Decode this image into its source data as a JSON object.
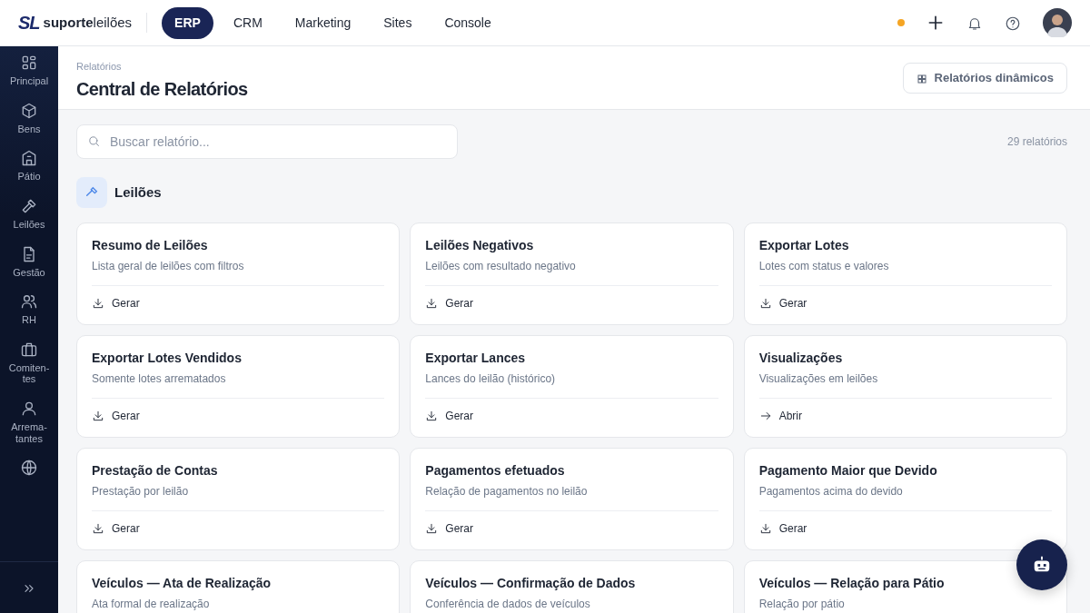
{
  "logo": {
    "mark": "SL",
    "name": "**suporte**leilões"
  },
  "nav": [
    {
      "label": "ERP",
      "selected": true
    },
    {
      "label": "CRM",
      "selected": false
    },
    {
      "label": "Marketing",
      "selected": false
    },
    {
      "label": "Sites",
      "selected": false
    },
    {
      "label": "Console",
      "selected": false
    }
  ],
  "sidebar": {
    "items": [
      {
        "label": "Principal",
        "selected": false
      },
      {
        "label": "Bens",
        "selected": false
      },
      {
        "label": "Pátio",
        "selected": false
      },
      {
        "label": "Leilões",
        "selected": false
      },
      {
        "label": "Gestão",
        "selected": false
      },
      {
        "label": "RH",
        "selected": false
      },
      {
        "label": "Comiten-\ntes",
        "selected": false
      },
      {
        "label": "Arrema-\ntantes",
        "selected": false
      },
      {
        "selected": false
      }
    ]
  },
  "page": {
    "breadcrumb": "Relatórios",
    "title": "Central de Relatórios",
    "action": "Relatórios dinâmicos"
  },
  "search": {
    "placeholder": "Buscar relatório...",
    "count": "29 relatórios"
  },
  "section": {
    "title": "Leilões"
  },
  "reports": [
    {
      "title": "Resumo de Leilões",
      "description": "Lista geral de leilões com filtros",
      "action": {
        "kind": "download",
        "label": "Gerar"
      }
    },
    {
      "title": "Leilões Negativos",
      "description": "Leilões com resultado negativo",
      "action": {
        "kind": "download",
        "label": "Gerar"
      }
    },
    {
      "title": "Exportar Lotes",
      "description": "Lotes com status e valores",
      "action": {
        "kind": "download",
        "label": "Gerar"
      }
    },
    {
      "title": "Exportar Lotes Vendidos",
      "description": "Somente lotes arrematados",
      "action": {
        "kind": "download",
        "label": "Gerar"
      }
    },
    {
      "title": "Exportar Lances",
      "description": "Lances do leilão (histórico)",
      "action": {
        "kind": "download",
        "label": "Gerar"
      }
    },
    {
      "title": "Visualizações",
      "description": "Visualizações em leilões",
      "action": {
        "kind": "open",
        "label": "Abrir"
      }
    },
    {
      "title": "Prestação de Contas",
      "description": "Prestação por leilão",
      "action": {
        "kind": "download",
        "label": "Gerar"
      }
    },
    {
      "title": "Pagamentos efetuados",
      "description": "Relação de pagamentos no leilão",
      "action": {
        "kind": "download",
        "label": "Gerar"
      }
    },
    {
      "title": "Pagamento Maior que Devido",
      "description": "Pagamentos acima do devido",
      "action": {
        "kind": "download",
        "label": "Gerar"
      }
    },
    {
      "title": "Veículos — Ata de Realização",
      "description": "Ata formal de realização"
    },
    {
      "title": "Veículos — Confirmação de Dados",
      "description": "Conferência de dados de veículos"
    },
    {
      "title": "Veículos — Relação para Pátio",
      "description": "Relação por pátio"
    }
  ]
}
